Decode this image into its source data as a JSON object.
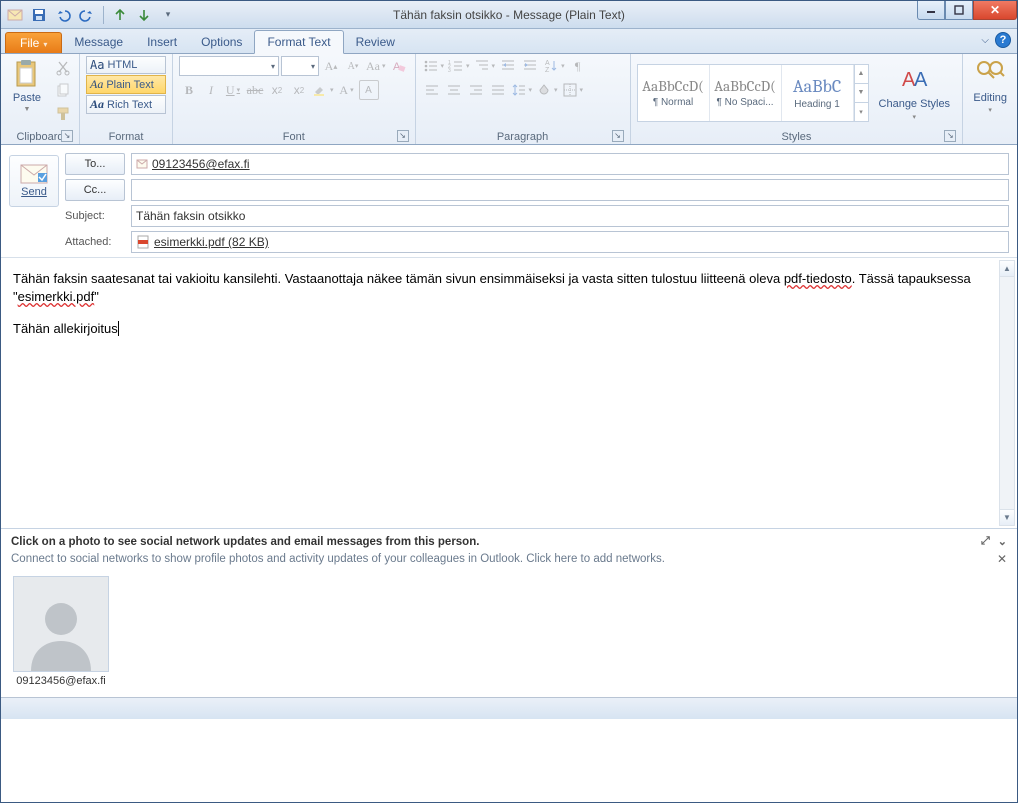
{
  "window": {
    "title": "Tähän faksin otsikko  -  Message (Plain Text)"
  },
  "tabs": {
    "file": "File",
    "items": [
      "Message",
      "Insert",
      "Options",
      "Format Text",
      "Review"
    ],
    "active_index": 3
  },
  "ribbon": {
    "clipboard": {
      "paste": "Paste",
      "label": "Clipboard"
    },
    "format": {
      "label": "Format",
      "html": "HTML",
      "plain": "Plain Text",
      "rich": "Rich Text"
    },
    "font": {
      "label": "Font"
    },
    "paragraph": {
      "label": "Paragraph"
    },
    "styles": {
      "label": "Styles",
      "change": "Change Styles",
      "items": [
        {
          "preview": "AaBbCcD(",
          "name": "¶ Normal"
        },
        {
          "preview": "AaBbCcD(",
          "name": "¶ No Spaci..."
        },
        {
          "preview": "AaBbC",
          "name": "Heading 1"
        }
      ]
    },
    "editing": {
      "label": "Editing"
    }
  },
  "header": {
    "send": "Send",
    "to_btn": "To...",
    "cc_btn": "Cc...",
    "subject_label": "Subject:",
    "attached_label": "Attached:",
    "to_value": "09123456@efax.fi",
    "cc_value": "",
    "subject_value": "Tähän faksin otsikko",
    "attachment_name": "esimerkki.pdf (82 KB)"
  },
  "body": {
    "line1a": "Tähän faksin saatesanat tai vakioitu kansilehti. Vastaanottaja näkee tämän sivun ensimmäiseksi ja vasta sitten tulostuu liitteenä oleva ",
    "line1b": "pdf-tiedosto",
    "line1c": ". Tässä tapauksessa \"",
    "line1d": "esimerkki.pdf",
    "line1e": "\"",
    "line2": "Tähän allekirjoitus"
  },
  "people": {
    "head": "Click on a photo to see social network updates and email messages from this person.",
    "sub": "Connect to social networks to show profile photos and activity updates of your colleagues in Outlook. Click here to add networks.",
    "contact": "09123456@efax.fi"
  }
}
